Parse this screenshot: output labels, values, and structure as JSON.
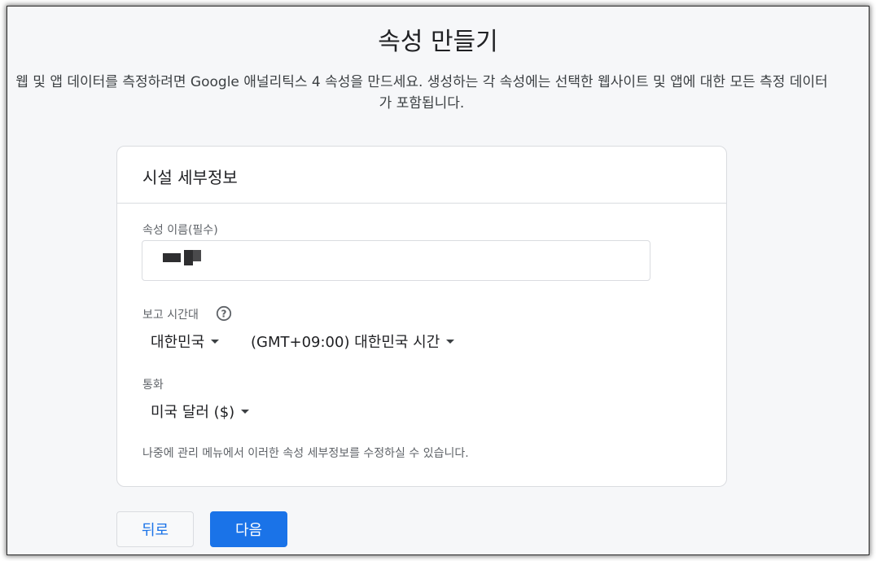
{
  "page": {
    "title": "속성 만들기",
    "intro": "웹 및 앱 데이터를 측정하려면 Google 애널리틱스 4 속성을 만드세요. 생성하는 각 속성에는 선택한 웹사이트 및 앱에 대한 모든 측정 데이터가 포함됩니다."
  },
  "card": {
    "header": "시설 세부정보",
    "property_name": {
      "label": "속성 이름(필수)",
      "value": ""
    },
    "timezone": {
      "label": "보고 시간대",
      "help_icon": "help-circle-icon",
      "country": "대한민국",
      "zone": "(GMT+09:00) 대한민국 시간"
    },
    "currency": {
      "label": "통화",
      "value": "미국 달러 ($)"
    },
    "note": "나중에 관리 메뉴에서 이러한 속성 세부정보를 수정하실 수 있습니다."
  },
  "buttons": {
    "back": "뒤로",
    "next": "다음"
  },
  "colors": {
    "primary": "#1a73e8",
    "background": "#f6f7f9",
    "border": "#dadce0"
  }
}
